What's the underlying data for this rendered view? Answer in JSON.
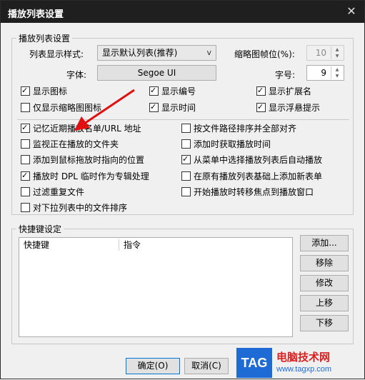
{
  "window": {
    "title": "播放列表设置",
    "close_icon": "close-icon"
  },
  "playlist_group": {
    "legend": "播放列表设置",
    "display_style_label": "列表显示样式:",
    "display_style_value": "显示默认列表(推荐)",
    "thumb_frame_label": "缩略图帧位(%):",
    "thumb_frame_value": "10",
    "font_label": "字体:",
    "font_button": "Segoe UI",
    "font_size_label": "字号:",
    "font_size_value": "9",
    "checkboxes_top": [
      {
        "label": "显示图标",
        "checked": true
      },
      {
        "label": "显示编号",
        "checked": true
      },
      {
        "label": "显示扩展名",
        "checked": true
      },
      {
        "label": "仅显示缩略图图标",
        "checked": false
      },
      {
        "label": "显示时间",
        "checked": true
      },
      {
        "label": "显示浮悬提示",
        "checked": true
      }
    ],
    "checkboxes_bottom_left": [
      {
        "label": "记忆近期播放名单/URL 地址",
        "checked": true
      },
      {
        "label": "监视正在播放的文件夹",
        "checked": false
      },
      {
        "label": "添加到鼠标拖放时指向的位置",
        "checked": false
      },
      {
        "label": "播放时 DPL 临时作为专辑处理",
        "checked": true
      },
      {
        "label": "过滤重复文件",
        "checked": false
      },
      {
        "label": "对下拉列表中的文件排序",
        "checked": false
      }
    ],
    "checkboxes_bottom_right": [
      {
        "label": "按文件路径排序并全部对齐",
        "checked": false
      },
      {
        "label": "添加时获取播放时间",
        "checked": false
      },
      {
        "label": "从菜单中选择播放列表后自动播放",
        "checked": true
      },
      {
        "label": "在原有播放列表基础上添加新表单",
        "checked": false
      },
      {
        "label": "开始播放时转移焦点到播放窗口",
        "checked": false
      }
    ]
  },
  "shortcut_group": {
    "legend": "快捷键设定",
    "columns": [
      "快捷键",
      "指令"
    ],
    "buttons": [
      "添加...",
      "移除",
      "修改",
      "上移",
      "下移"
    ]
  },
  "footer": {
    "ok": "确定(O)",
    "cancel": "取消(C)"
  },
  "watermark": {
    "tag": "TAG",
    "text": "电脑技术网",
    "url": "www.tagxp.com"
  },
  "annotation": {
    "arrow_color": "#e01010"
  }
}
